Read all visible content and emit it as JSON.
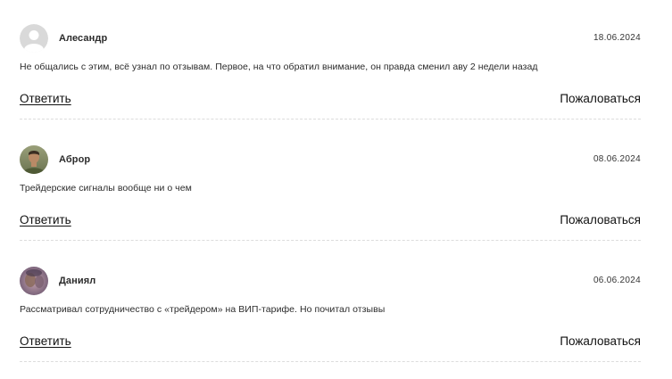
{
  "comments": [
    {
      "author": "Алесандр",
      "date": "18.06.2024",
      "text": "Не общались с этим, всё узнал по отзывам. Первое, на что обратил внимание, он правда сменил аву 2 недели назад",
      "avatar": "default-user-icon",
      "reply_label": "Ответить",
      "report_label": "Пожаловаться"
    },
    {
      "author": "Аброр",
      "date": "08.06.2024",
      "text": "Трейдерские сигналы вообще ни о чем",
      "avatar": "user-photo",
      "reply_label": "Ответить",
      "report_label": "Пожаловаться"
    },
    {
      "author": "Даниял",
      "date": "06.06.2024",
      "text": "Рассматривал сотрудничество с «трейдером» на ВИП-тарифе. Но почитал отзывы",
      "avatar": "user-photo",
      "reply_label": "Ответить",
      "report_label": "Пожаловаться"
    }
  ],
  "colors": {
    "text": "#2b2b2b",
    "divider": "#dcdcdc",
    "default_avatar_bg": "#d9d9d9"
  }
}
